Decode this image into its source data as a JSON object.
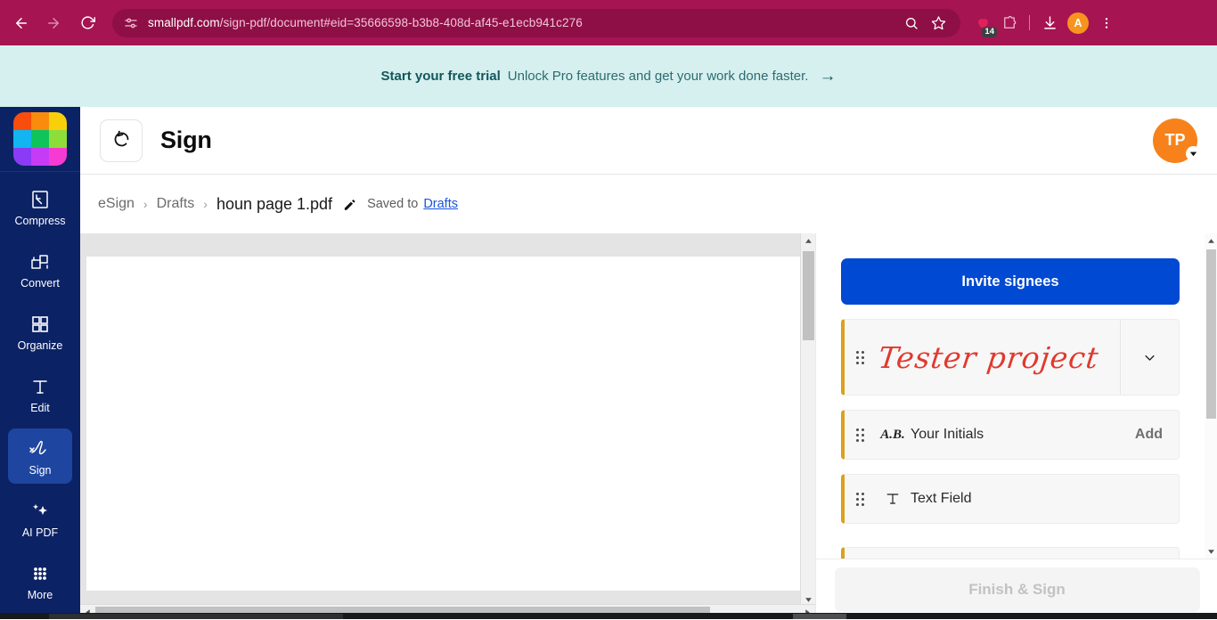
{
  "browser": {
    "url_host": "smallpdf.com",
    "url_path": "/sign-pdf/document#eid=35666598-b3b8-408d-af45-e1ecb941c276",
    "back_icon": "back-arrow-icon",
    "forward_icon": "forward-arrow-icon",
    "reload_icon": "reload-icon",
    "site_info_icon": "site-settings-icon",
    "zoom_icon": "search-zoom-icon",
    "bookmark_icon": "star-icon",
    "extension_badge_count": "14",
    "puzzle_icon": "extensions-puzzle-icon",
    "download_icon": "download-icon",
    "profile_initial": "A",
    "menu_icon": "three-dot-menu-icon"
  },
  "promo": {
    "bold": "Start your free trial",
    "text": "Unlock Pro features and get your work done faster.",
    "arrow": "→"
  },
  "sidebar": {
    "logo": "smallpdf-logo",
    "logo_colors": [
      "#f94d0c",
      "#f98c0c",
      "#f9cf0c",
      "#12b5f0",
      "#10c45c",
      "#8ede3a",
      "#8b3bf5",
      "#c63bf5",
      "#f53bd2"
    ],
    "items": [
      {
        "label": "Compress",
        "icon": "compress-icon",
        "active": false
      },
      {
        "label": "Convert",
        "icon": "convert-icon",
        "active": false
      },
      {
        "label": "Organize",
        "icon": "organize-grid-icon",
        "active": false
      },
      {
        "label": "Edit",
        "icon": "text-edit-icon",
        "active": false
      },
      {
        "label": "Sign",
        "icon": "signature-icon",
        "active": true
      },
      {
        "label": "AI PDF",
        "icon": "sparkles-icon",
        "active": false
      },
      {
        "label": "More",
        "icon": "grid-dots-icon",
        "active": false
      }
    ]
  },
  "header": {
    "undo_icon": "undo-icon",
    "title": "Sign",
    "avatar_initials": "TP",
    "avatar_color": "#f7821b",
    "caret_icon": "chevron-down-icon"
  },
  "breadcrumb": {
    "crumb1": "eSign",
    "sep": "›",
    "crumb2": "Drafts",
    "file": "houn page 1.pdf",
    "pencil_icon": "pencil-edit-icon",
    "saved_label": "Saved to",
    "saved_link": "Drafts"
  },
  "panel": {
    "invite_label": "Invite signees",
    "invite_color": "#0049d2",
    "accent_color": "#d9a21b",
    "signature": {
      "text": "Tester project",
      "color": "#e03a2f",
      "handle_icon": "drag-handle-icon",
      "expand_icon": "chevron-down-icon"
    },
    "rows": [
      {
        "label": "Your Initials",
        "glyph": "A.B.",
        "icon": "initials-icon",
        "handle_icon": "drag-handle-icon",
        "action": "Add"
      },
      {
        "label": "Text Field",
        "glyph": "T",
        "icon": "text-field-icon",
        "handle_icon": "drag-handle-icon",
        "action": ""
      }
    ],
    "finish_label": "Finish & Sign"
  }
}
